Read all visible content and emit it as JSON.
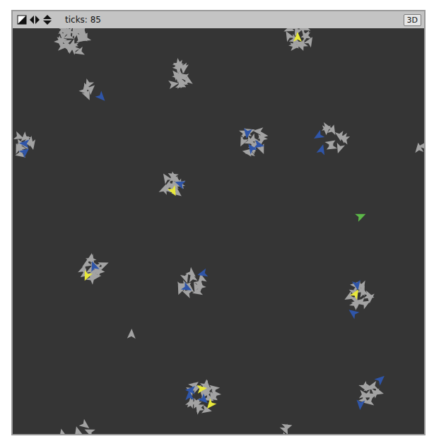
{
  "toolbar": {
    "ticks": "ticks: 85",
    "view_button": "3D"
  },
  "agents": [
    {
      "color": "#e8e83a"
    },
    {
      "color": "#2f55a8"
    },
    {
      "color": "#2f55a8"
    },
    {
      "color": "#2f55a8"
    },
    {
      "color": "#2f55a8"
    },
    {
      "color": "#2f55a8"
    },
    {
      "color": "#2f55a8"
    },
    {
      "color": "#2f55a8"
    },
    {
      "color": "#2f55a8"
    },
    {
      "color": "#e8e83a"
    },
    {
      "color": "#2f55a8"
    },
    {
      "color": "#5cb848"
    },
    {
      "color": "#e8e83a"
    },
    {
      "color": "#2f55a8"
    },
    {
      "color": "#2f55a8"
    },
    {
      "color": "#2f55a8"
    },
    {
      "color": "#e8e83a"
    },
    {
      "color": "#2f55a8"
    },
    {
      "color": "#2f55a8"
    },
    {
      "color": "#e8e83a"
    },
    {
      "color": "#e8e83a"
    },
    {
      "color": "#2f55a8"
    },
    {
      "color": "#2f55a8"
    },
    {
      "color": "#2f55a8"
    },
    {
      "color": "#2f55a8"
    },
    {
      "color": "#2f55a8"
    }
  ]
}
